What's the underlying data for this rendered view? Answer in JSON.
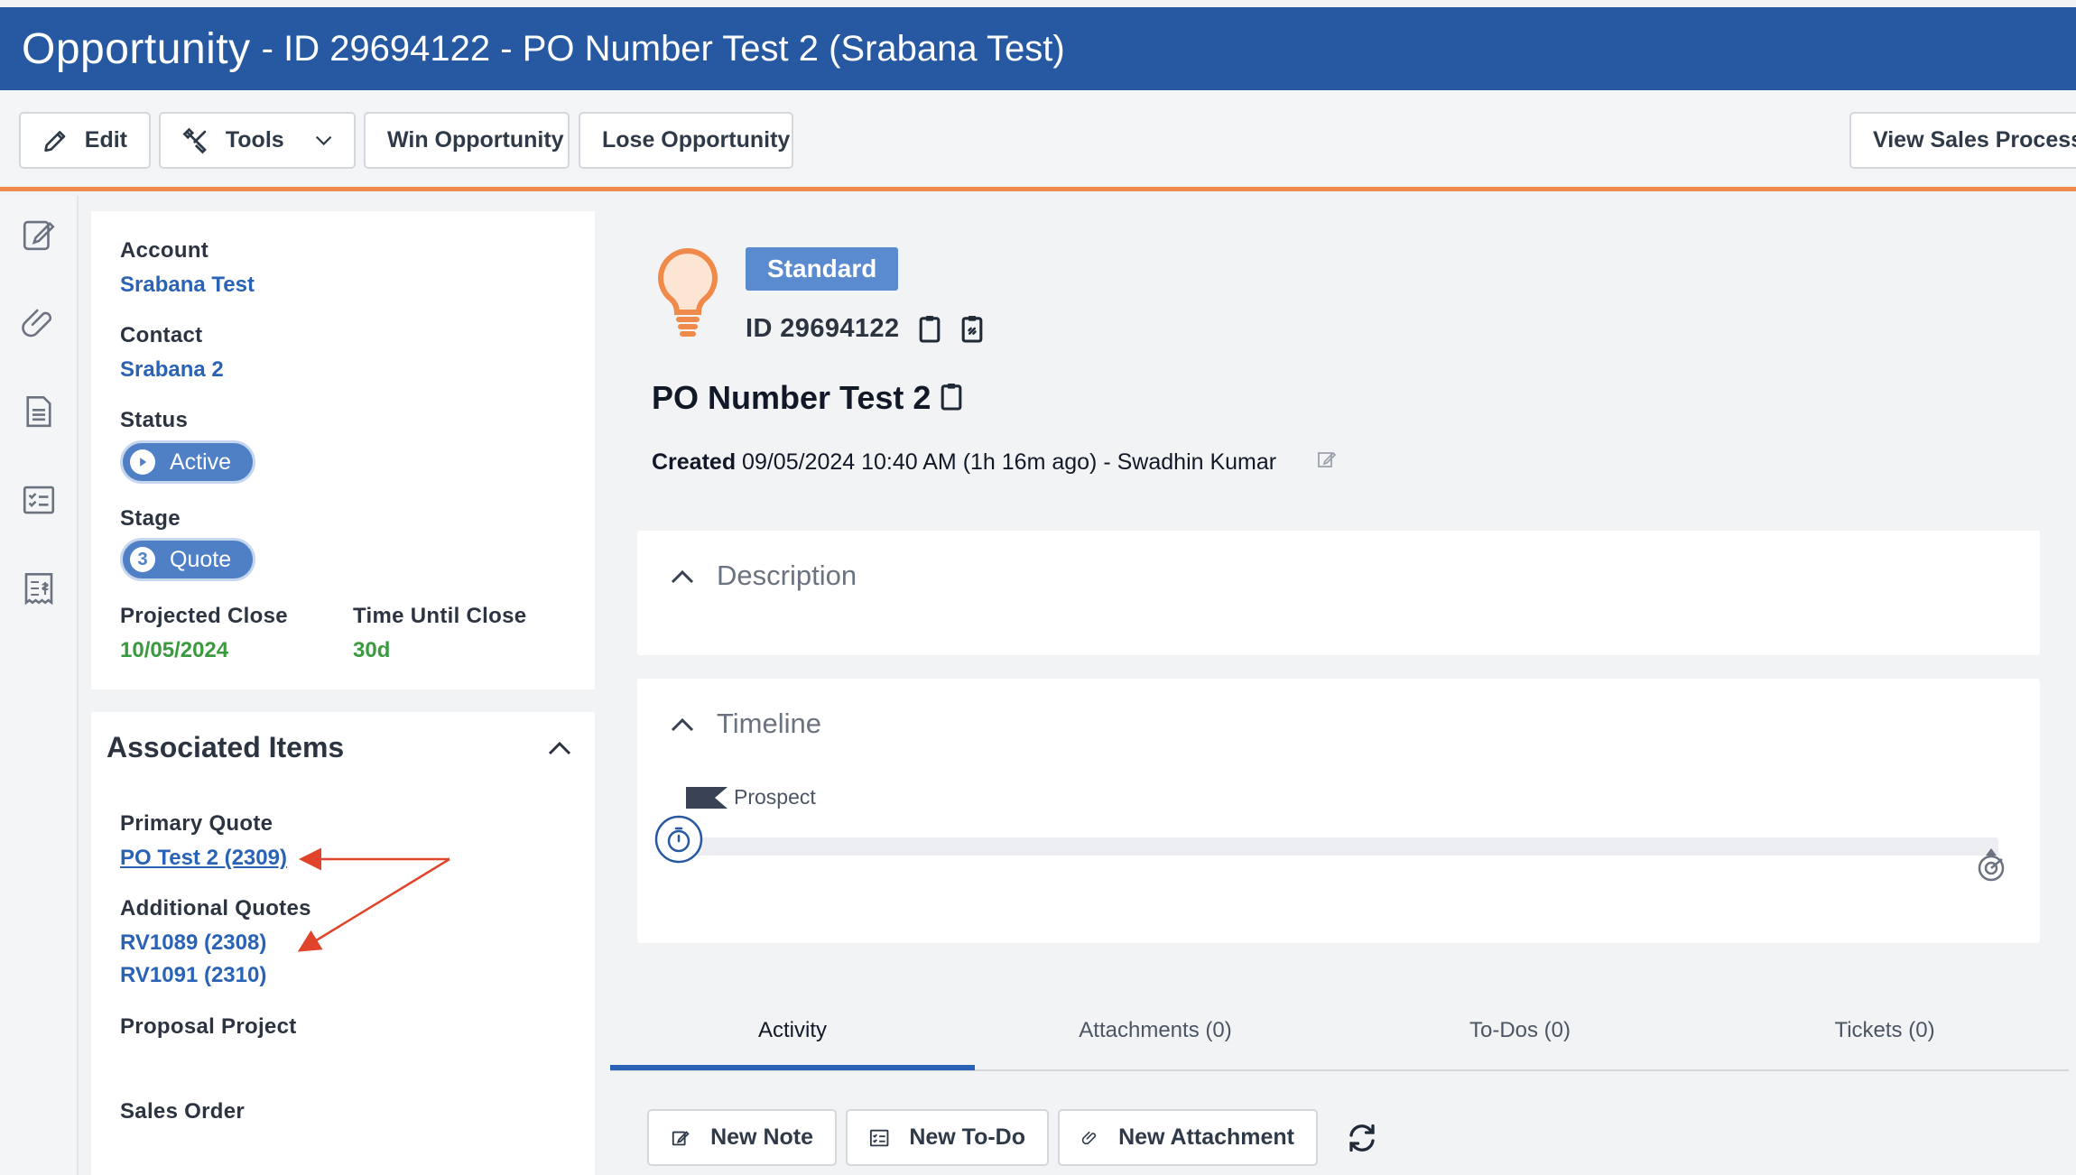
{
  "header": {
    "title": "Opportunity",
    "subtitle": "- ID 29694122 - PO Number Test 2 (Srabana Test)"
  },
  "toolbar": {
    "edit_label": "Edit",
    "tools_label": "Tools",
    "win_label": "Win Opportunity",
    "lose_label": "Lose Opportunity",
    "view_sales_label": "View Sales Process"
  },
  "details": {
    "account_label": "Account",
    "account_value": "Srabana Test",
    "contact_label": "Contact",
    "contact_value": "Srabana 2",
    "status_label": "Status",
    "status_value": "Active",
    "stage_label": "Stage",
    "stage_number": "3",
    "stage_value": "Quote",
    "projected_close_label": "Projected Close",
    "projected_close_value": "10/05/2024",
    "time_until_close_label": "Time Until Close",
    "time_until_close_value": "30d"
  },
  "associated": {
    "title": "Associated Items",
    "primary_quote_label": "Primary Quote",
    "primary_quote_value": "PO Test 2 (2309)",
    "additional_quotes_label": "Additional Quotes",
    "additional_quotes": [
      "RV1089 (2308)",
      "RV1091 (2310)"
    ],
    "proposal_project_label": "Proposal Project",
    "sales_order_label": "Sales Order"
  },
  "summary": {
    "badge": "Standard",
    "id_text": "ID 29694122",
    "name": "PO Number Test 2",
    "created_label": "Created",
    "created_value": "09/05/2024 10:40 AM (1h 16m ago)",
    "creator_separator": "-",
    "creator": "Swadhin Kumar"
  },
  "description": {
    "title": "Description"
  },
  "timeline": {
    "title": "Timeline",
    "stage_label": "Prospect"
  },
  "tabs": [
    "Activity",
    "Attachments (0)",
    "To-Dos (0)",
    "Tickets (0)"
  ],
  "actions": {
    "new_note": "New Note",
    "new_todo": "New To-Do",
    "new_attachment": "New Attachment"
  },
  "colors": {
    "header_blue": "#2659a1",
    "accent_orange": "#f08a4b",
    "link_blue": "#2a63b6",
    "green": "#3a9a3e",
    "annotation_red": "#e0452b"
  }
}
